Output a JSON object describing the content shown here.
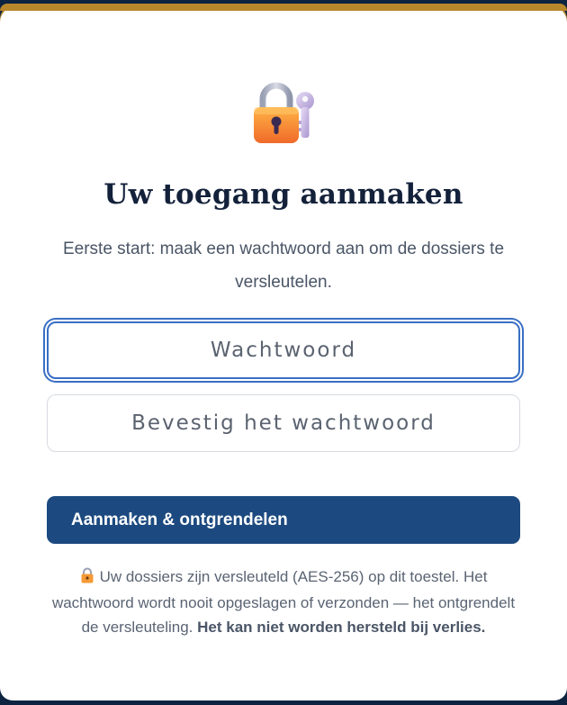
{
  "title": "Uw toegang aanmaken",
  "subtitle": "Eerste start: maak een wachtwoord aan om de dossiers te versleutelen.",
  "form": {
    "password_placeholder": "Wachtwoord",
    "confirm_placeholder": "Bevestig het wachtwoord",
    "submit_label": "Aanmaken & ontgrendelen"
  },
  "note": {
    "text": "Uw dossiers zijn versleuteld (AES-256) op dit toestel. Het wachtwoord wordt nooit opgeslagen of verzonden — het ontgrendelt de versleuteling.",
    "emphasis": "Het kan niet worden hersteld bij verlies."
  },
  "icons": {
    "hero": "lock-with-key-icon",
    "note": "lock-icon"
  },
  "colors": {
    "accent": "#1c4a80",
    "focus": "#3a6fc4",
    "top_border": "#b8862b"
  }
}
